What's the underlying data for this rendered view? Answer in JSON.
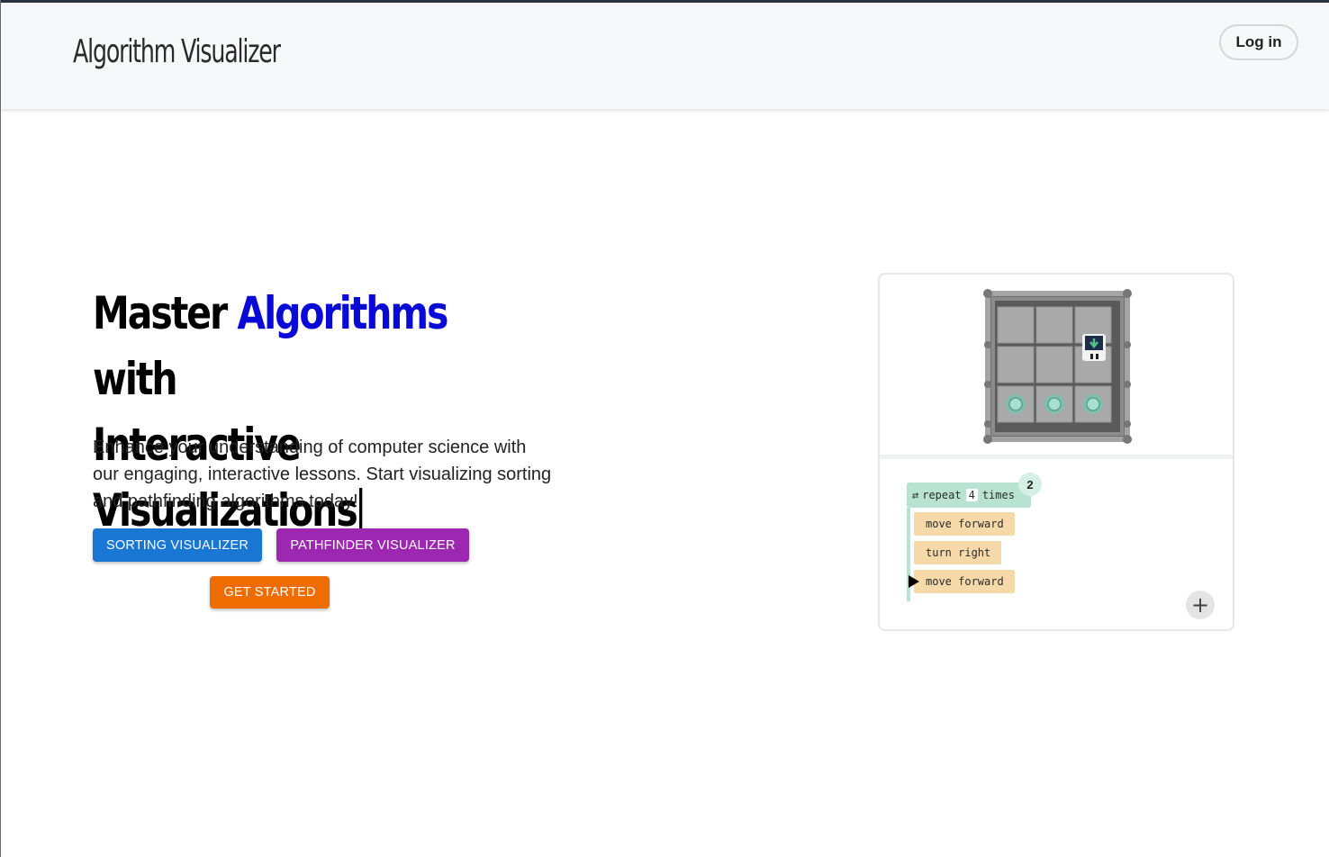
{
  "navbar": {
    "brand": "Algorithm Visualizer",
    "login_label": "Log in"
  },
  "hero": {
    "title_part1": "Master ",
    "title_accent": "Algorithms",
    "title_part2": " with",
    "title_line2": "Interactive Visualizations",
    "description": "Enhance your understanding of computer science with our engaging, interactive lessons. Start visualizing sorting and pathfinding algorithms today!",
    "buttons": {
      "sorting": "SORTING VISUALIZER",
      "pathfinder": "PATHFINDER VISUALIZER",
      "get_started": "GET STARTED"
    }
  },
  "preview": {
    "repeat_keyword": "repeat",
    "repeat_count": "4",
    "repeat_suffix": "times",
    "badge": "2",
    "commands": [
      "move forward",
      "turn right",
      "move forward"
    ],
    "add_icon": "+"
  },
  "colors": {
    "accent": "#0a0ad6",
    "sorting_button": "#1976d2",
    "pathfinder_button": "#9c27b0",
    "get_started_button": "#ef6c00"
  }
}
